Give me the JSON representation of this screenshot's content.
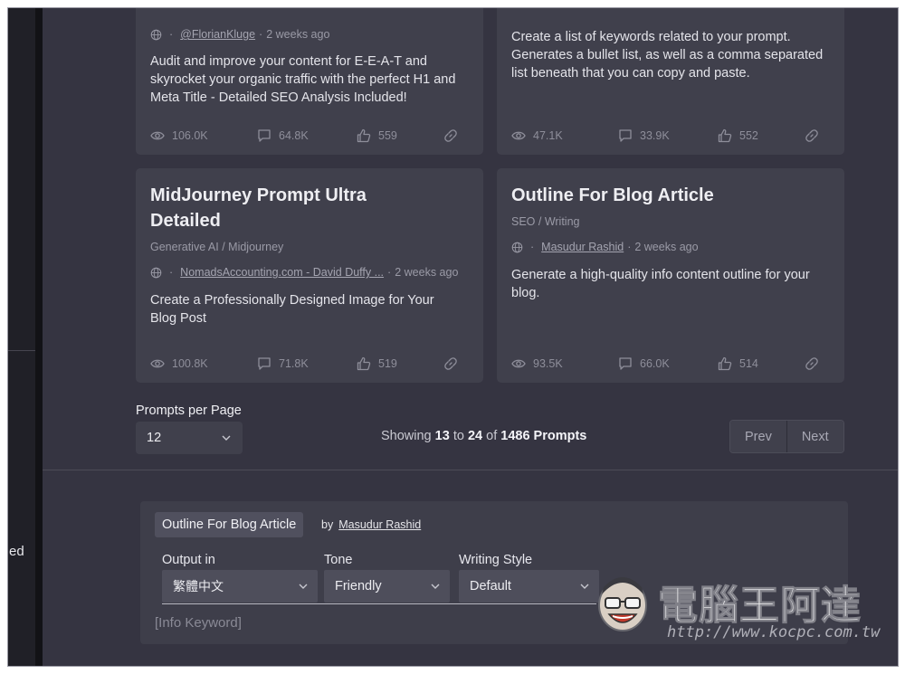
{
  "cards": [
    {
      "id": "card-eeat",
      "title": "",
      "category": "",
      "author": "@FlorianKluge",
      "time": "2 weeks ago",
      "description": "Audit and improve your content for E-E-A-T and skyrocket your organic traffic with the perfect H1 and Meta Title - Detailed SEO Analysis Included!",
      "views": "106.0K",
      "comments": "64.8K",
      "likes": "559"
    },
    {
      "id": "card-keywords",
      "title": "",
      "category": "",
      "author": "",
      "time": "",
      "description": "Create a list of keywords related to your prompt. Generates a bullet list, as well as a comma separated list beneath that you can copy and paste.",
      "views": "47.1K",
      "comments": "33.9K",
      "likes": "552"
    },
    {
      "id": "card-midjourney",
      "title": "MidJourney Prompt Ultra Detailed",
      "category": "Generative AI / Midjourney",
      "author": "NomadsAccounting.com - David Duffy ...",
      "time": "2 weeks ago",
      "description": "Create a Professionally Designed Image for Your Blog Post",
      "views": "100.8K",
      "comments": "71.8K",
      "likes": "519"
    },
    {
      "id": "card-outline",
      "title": "Outline For Blog Article",
      "category": "SEO / Writing",
      "author": "Masudur Rashid",
      "time": "2 weeks ago",
      "description": "Generate a high-quality info content outline for your blog.",
      "views": "93.5K",
      "comments": "66.0K",
      "likes": "514"
    }
  ],
  "pagination": {
    "per_page_label": "Prompts per Page",
    "per_page_value": "12",
    "showing_prefix": "Showing",
    "from": "13",
    "to_word": "to",
    "to": "24",
    "of_word": "of",
    "total": "1486 Prompts",
    "prev": "Prev",
    "next": "Next"
  },
  "panel": {
    "prompt_title": "Outline For Blog Article",
    "by": "by",
    "author": "Masudur Rashid",
    "output_label": "Output in",
    "output_value": "繁體中文",
    "tone_label": "Tone",
    "tone_value": "Friendly",
    "style_label": "Writing Style",
    "style_value": "Default",
    "placeholder": "[Info Keyword]"
  },
  "sidebar": {
    "cut_text": "ed"
  },
  "watermark": {
    "text": "電腦王阿達",
    "url": "http://www.kocpc.com.tw"
  },
  "colors": {
    "background": "#353441",
    "card": "#40404c",
    "sidebar": "#202027"
  },
  "icons": [
    "globe-icon",
    "eye-icon",
    "comment-icon",
    "thumbs-up-icon",
    "link-icon",
    "chevron-down-icon"
  ]
}
